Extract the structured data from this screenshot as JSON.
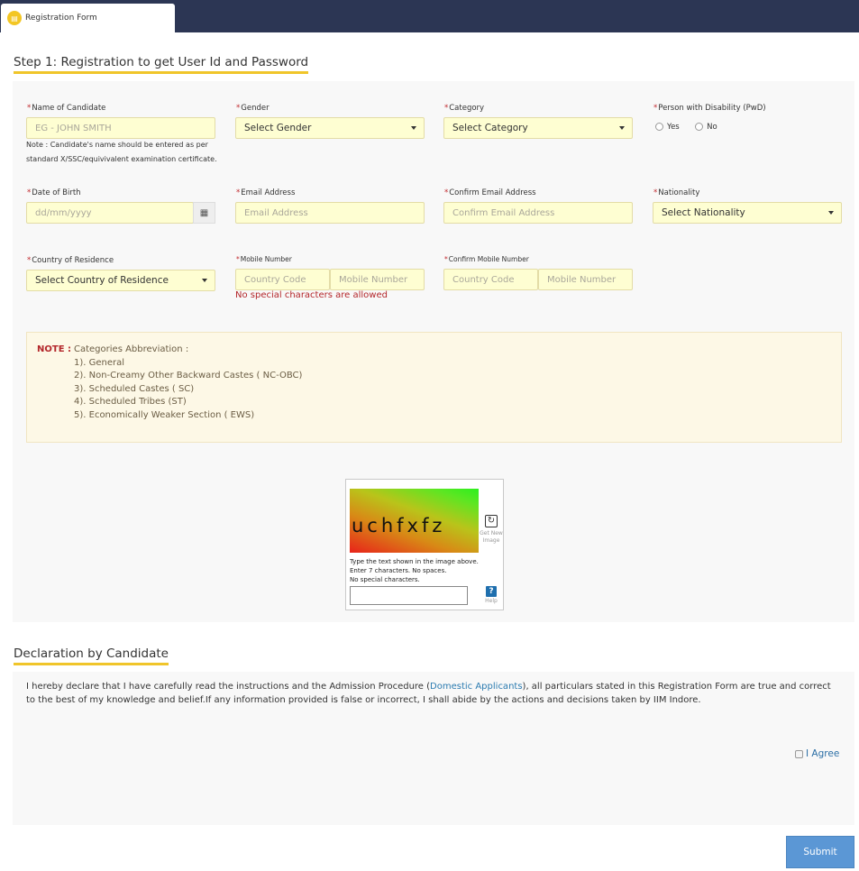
{
  "tab": {
    "title": "Registration Form"
  },
  "step1": {
    "heading": "Step 1: Registration to get User Id and Password"
  },
  "fields": {
    "name": {
      "label": "Name of Candidate",
      "placeholder": "EG -  JOHN SMITH",
      "note": "Note : Candidate's name should be entered as per standard X/SSC/equivivalent examination certificate."
    },
    "gender": {
      "label": "Gender",
      "selected": "Select Gender"
    },
    "category": {
      "label": "Category",
      "selected": "Select Category"
    },
    "pwd": {
      "label": "Person with Disability (PwD)",
      "options": [
        "Yes",
        "No"
      ]
    },
    "dob": {
      "label": "Date of Birth",
      "placeholder": "dd/mm/yyyy"
    },
    "email": {
      "label": "Email Address",
      "placeholder": "Email Address"
    },
    "confirm_email": {
      "label": "Confirm Email Address",
      "placeholder": "Confirm Email Address"
    },
    "nationality": {
      "label": "Nationality",
      "selected": "Select Nationality"
    },
    "country": {
      "label": "Country of Residence",
      "selected": "Select Country of Residence"
    },
    "mobile": {
      "label": "Mobile Number",
      "code_placeholder": "Country Code",
      "number_placeholder": "Mobile Number",
      "error": "No special characters are allowed"
    },
    "confirm_mobile": {
      "label": "Confirm Mobile Number",
      "code_placeholder": "Country Code",
      "number_placeholder": "Mobile Number"
    }
  },
  "required_mark": "*",
  "note": {
    "label": "NOTE :",
    "title": "Categories Abbreviation :",
    "items": [
      "1). General",
      "2). Non-Creamy Other Backward Castes ( NC-OBC)",
      "3). Scheduled Castes ( SC)",
      "4). Scheduled Tribes (ST)",
      "5). Economically Weaker Section ( EWS)"
    ]
  },
  "captcha": {
    "image_text": "uchfxfz",
    "refresh_label": "Get New Image",
    "instructions": [
      "Type the text shown in the image above.",
      "Enter 7 characters. No spaces.",
      "No special characters."
    ],
    "help_label": "Help"
  },
  "declaration": {
    "heading": "Declaration by Candidate",
    "text_before": "I hereby declare that I have carefully read the instructions and the Admission Procedure (",
    "link": "Domestic Applicants",
    "text_after": "), all particulars stated in this Registration Form are true and correct to the best of my knowledge and belief.If any information provided is false or incorrect, I shall abide by the actions and decisions taken by IIM Indore.",
    "agree_label": "I Agree"
  },
  "submit_label": "Submit",
  "colors": {
    "topbar": "#2c3654",
    "accent": "#f0c52a",
    "input_bg": "#fefed2",
    "error": "#b3262a",
    "submit": "#5b97d5",
    "link": "#2b7bb0"
  }
}
